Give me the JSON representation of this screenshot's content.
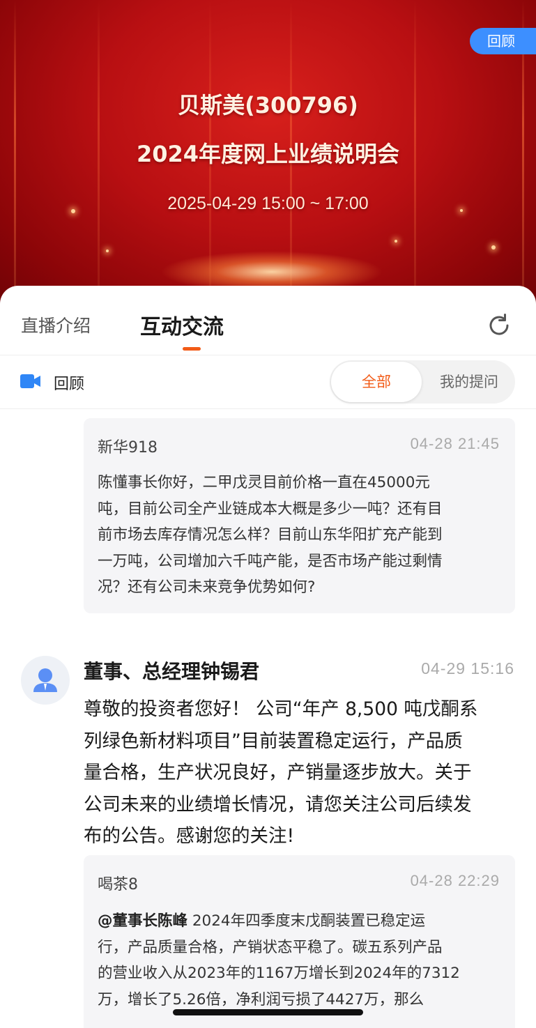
{
  "banner": {
    "replay_label": "回顾",
    "title_line1": "贝斯美(300796)",
    "title_line2": "2024年度网上业绩说明会",
    "time_range": "2025-04-29 15:00 ~ 17:00"
  },
  "tabs": [
    {
      "label": "直播介绍",
      "active": false
    },
    {
      "label": "互动交流",
      "active": true
    }
  ],
  "filter": {
    "replay_label": "回顾",
    "segments": [
      {
        "label": "全部",
        "selected": true
      },
      {
        "label": "我的提问",
        "selected": false
      }
    ]
  },
  "feed": {
    "question1": {
      "user": "新华918",
      "time": "04-28 21:45",
      "lines": [
        "陈懂事长你好，二甲戊灵目前价格一直在45000元",
        "吨，目前公司全产业链成本大概是多少一吨？还有目",
        "前市场去库存情况怎么样？目前山东华阳扩充产能到",
        "一万吨，公司增加六千吨产能，是否市场产能过剩情",
        "况？还有公司未来竞争优势如何?"
      ]
    },
    "answer": {
      "name": "董事、总经理钟锡君",
      "time": "04-29 15:16",
      "lines": [
        "尊敬的投资者您好！ 公司“年产 8,500 吨戊酮系",
        "列绿色新材料项目”目前装置稳定运行，产品质",
        "量合格，生产状况良好，产销量逐步放大。关于",
        "公司未来的业绩增长情况，请您关注公司后续发",
        "布的公告。感谢您的关注!"
      ]
    },
    "question2": {
      "user": "喝茶8",
      "time": "04-28 22:29",
      "mention": "@董事长陈峰",
      "line1_rest": " 2024年四季度末戊酮装置已稳定运",
      "lines": [
        "行，产品质量合格，产销状态平稳了。碳五系列产品",
        "的营业收入从2023年的1167万增长到2024年的7312",
        "万，增长了5.26倍，净利润亏损了4427万，那么"
      ]
    }
  },
  "colors": {
    "accent": "#f25b17",
    "banner_red": "#b80f12",
    "replay_blue": "#3d8fff"
  },
  "icons": [
    "refresh-icon",
    "video-camera-icon",
    "user-avatar-icon"
  ]
}
